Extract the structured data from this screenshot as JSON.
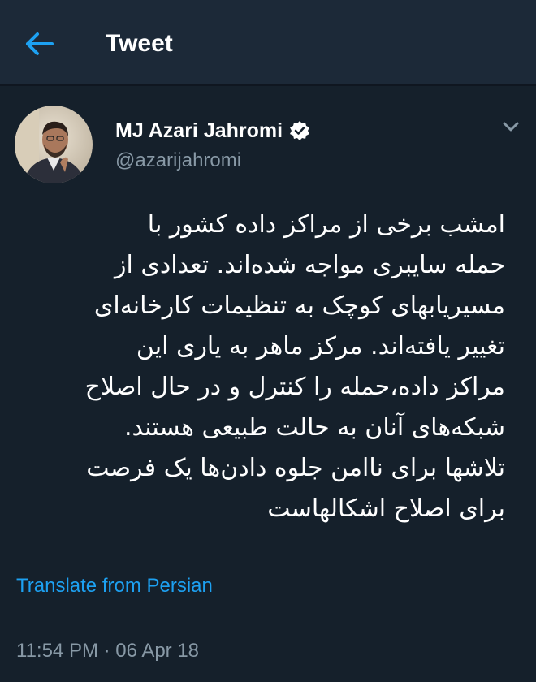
{
  "header": {
    "back_icon": "arrow-left-icon",
    "title": "Tweet"
  },
  "author": {
    "name": "MJ Azari Jahromi",
    "handle": "@azarijahromi",
    "verified_icon": "verified-badge-icon"
  },
  "menu_icon": "chevron-down-icon",
  "tweet": {
    "text": "امشب برخی از مراکز داده کشور با\nحمله سایبری مواجه شده‌اند. تعدادی از\nمسیریابهای کوچک به تنظیمات کارخانه‌ای\nتغییر یافته‌اند. مرکز ماهر به یاری این\nمراکز داده،حمله را کنترل و در حال اصلاح\nشبکه‌های آنان به حالت طبیعی هستند.\nتلاشها برای ناامن جلوه دادن‌ها یک فرصت\nبرای اصلاح اشکالهاست",
    "translate_label": "Translate from Persian",
    "timestamp": "11:54 PM · 06 Apr 18"
  },
  "colors": {
    "background": "#15202b",
    "header": "#1c2938",
    "accent": "#1da1f2",
    "secondary_text": "#8899a6"
  }
}
